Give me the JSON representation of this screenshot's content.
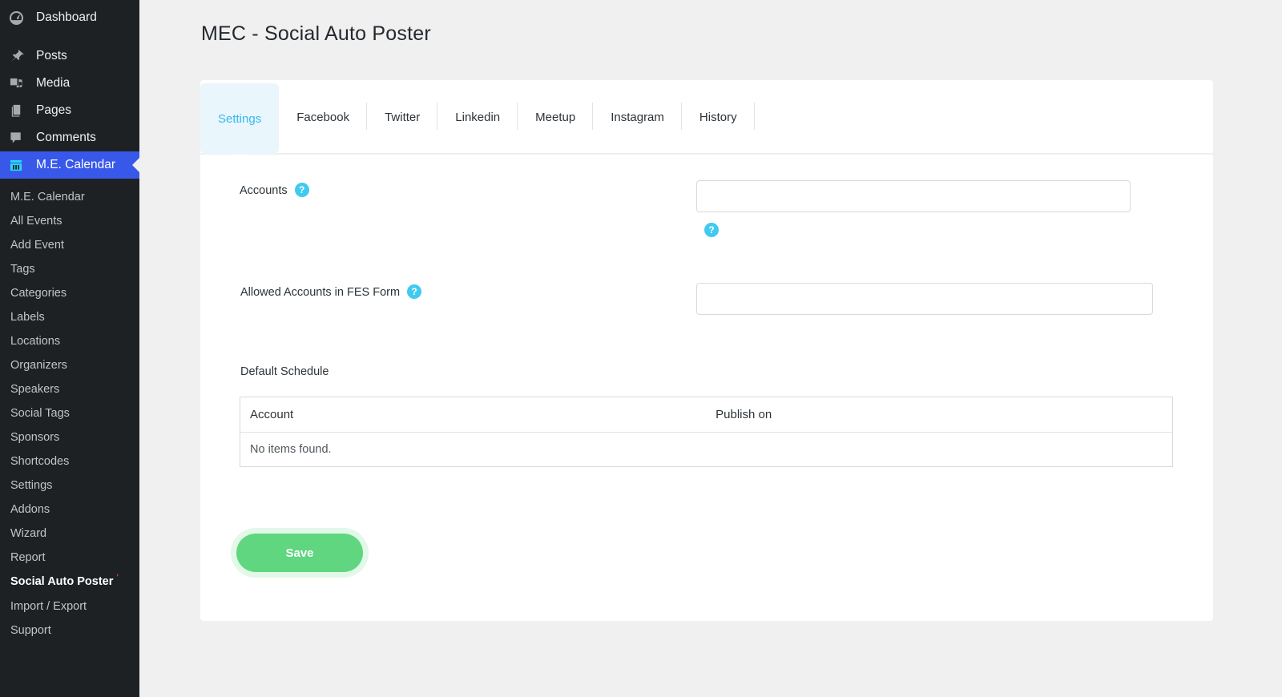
{
  "sidebar": {
    "top_items": [
      {
        "label": "Dashboard",
        "icon": "dashboard-icon",
        "active": false
      },
      {
        "label": "Posts",
        "icon": "pin-icon",
        "active": false
      },
      {
        "label": "Media",
        "icon": "media-icon",
        "active": false
      },
      {
        "label": "Pages",
        "icon": "pages-icon",
        "active": false
      },
      {
        "label": "Comments",
        "icon": "comments-icon",
        "active": false
      },
      {
        "label": "M.E. Calendar",
        "icon": "calendar-icon",
        "active": true
      }
    ],
    "submenu_items": [
      {
        "label": "M.E. Calendar",
        "current": false
      },
      {
        "label": "All Events",
        "current": false
      },
      {
        "label": "Add Event",
        "current": false
      },
      {
        "label": "Tags",
        "current": false
      },
      {
        "label": "Categories",
        "current": false
      },
      {
        "label": "Labels",
        "current": false
      },
      {
        "label": "Locations",
        "current": false
      },
      {
        "label": "Organizers",
        "current": false
      },
      {
        "label": "Speakers",
        "current": false
      },
      {
        "label": "Social Tags",
        "current": false
      },
      {
        "label": "Sponsors",
        "current": false
      },
      {
        "label": "Shortcodes",
        "current": false
      },
      {
        "label": "Settings",
        "current": false
      },
      {
        "label": "Addons",
        "current": false
      },
      {
        "label": "Wizard",
        "current": false
      },
      {
        "label": "Report",
        "current": false
      },
      {
        "label": "Social Auto Poster",
        "current": true,
        "badge": "'"
      },
      {
        "label": "Import / Export",
        "current": false
      },
      {
        "label": "Support",
        "current": false
      }
    ],
    "active_color": "#3858ea",
    "background": "#1d2124"
  },
  "page": {
    "title": "MEC - Social Auto Poster"
  },
  "tabs": [
    {
      "label": "Settings",
      "active": true
    },
    {
      "label": "Facebook",
      "active": false
    },
    {
      "label": "Twitter",
      "active": false
    },
    {
      "label": "Linkedin",
      "active": false
    },
    {
      "label": "Meetup",
      "active": false
    },
    {
      "label": "Instagram",
      "active": false
    },
    {
      "label": "History",
      "active": false
    }
  ],
  "form": {
    "accounts": {
      "label": "Accounts",
      "help_icon": "question-mark-icon",
      "value": "",
      "placeholder": "",
      "secondary_help_icon": "question-mark-icon"
    },
    "allowed_accounts_fes": {
      "label": "Allowed Accounts in FES Form",
      "help_icon": "question-mark-icon",
      "value": "",
      "placeholder": ""
    },
    "default_schedule": {
      "title": "Default Schedule",
      "columns": [
        "Account",
        "Publish on"
      ],
      "rows": [],
      "empty_message": "No items found."
    },
    "save_label": "Save",
    "save_color": "#5fd67f"
  },
  "colors": {
    "help_icon": "#40caf0",
    "active_tab_bg": "#e9f6fc",
    "active_tab_text": "#35b9ef",
    "page_bg": "#f0f0f1"
  }
}
